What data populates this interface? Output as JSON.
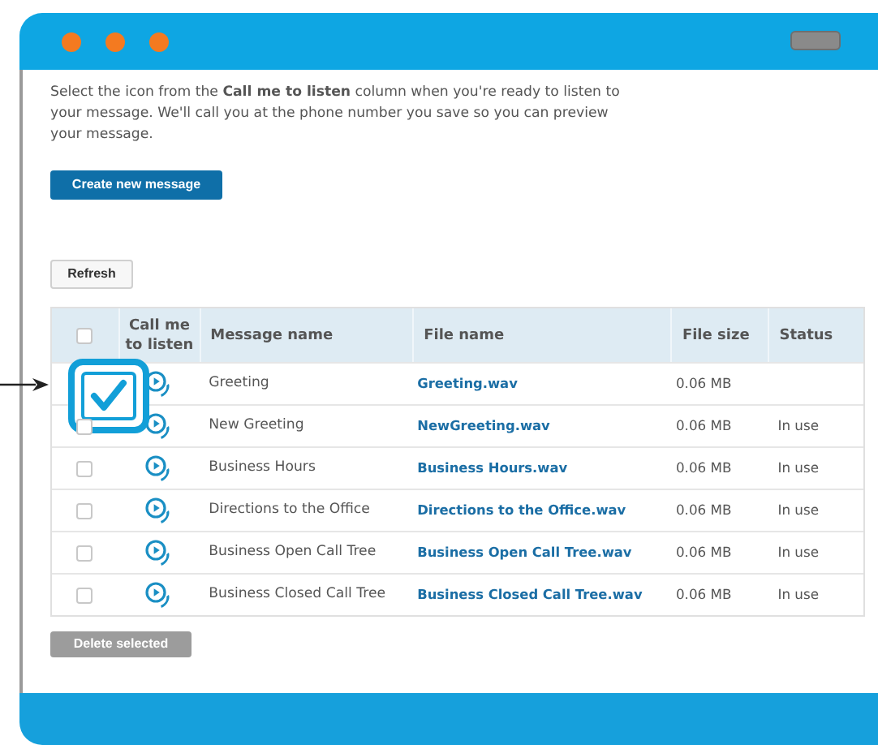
{
  "intro": "Select the icon from the **Call me to listen** column when you're ready to listen to your message. We'll call you at the phone number you save so you can preview your message.",
  "create_button": "Create new message",
  "refresh_button": "Refresh",
  "table": {
    "select_all": {
      "checked": false
    },
    "columns": [
      "Call me to listen",
      "Message name",
      "File name",
      "File size",
      "Status"
    ],
    "rows": [
      {
        "checked": true,
        "name": "Greeting",
        "file": "Greeting.wav",
        "size": "0.06 MB"
      },
      {
        "checked": false,
        "name": "New Greeting",
        "file": "NewGreeting.wav",
        "size": "0.06 MB",
        "status": "In use"
      },
      {
        "checked": false,
        "name": "Business Hours",
        "file": "Business Hours.wav",
        "size": "0.06 MB",
        "status": "In use"
      },
      {
        "checked": false,
        "name": "Directions to the Office",
        "file": "Directions to the Office.wav",
        "size": "0.06 MB",
        "status": "In use"
      },
      {
        "checked": false,
        "name": "Business Open Call Tree",
        "file": "Business Open Call Tree.wav",
        "size": "0.06 MB",
        "status": "In use"
      },
      {
        "checked": false,
        "name": "Business Closed Call Tree",
        "file": "Business Closed Call Tree.wav",
        "size": "0.06 MB",
        "status": "In use"
      }
    ]
  },
  "delete_button": {
    "label": "Delete selected",
    "disabled": true
  }
}
